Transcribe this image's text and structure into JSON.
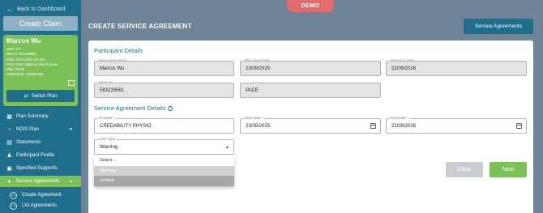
{
  "sidebar": {
    "back_label": "Back to Dashboard",
    "create_claim_label": "Create Claim",
    "user": {
      "name": "Marcos Wu",
      "lines": [
        "State: NT",
        "NDIS #: 583228561",
        "DOB: 01/01/2001 (24 yrs)",
        "Price Zone: National Very Remote",
        "Plan: PACE",
        "23/09/2025 - 22/09/2026"
      ],
      "switch_plan_label": "Switch Plan"
    },
    "nav": [
      {
        "label": "Plan Summary",
        "icon": "grid-icon"
      },
      {
        "label": "NDIS Plan",
        "icon": "gauge-icon"
      },
      {
        "label": "Statements",
        "icon": "document-icon"
      },
      {
        "label": "Participant Profile",
        "icon": "people-icon"
      },
      {
        "label": "Specified Supports",
        "icon": "book-icon"
      },
      {
        "label": "Service Agreements",
        "icon": "handshake-icon"
      }
    ],
    "sub_nav": [
      {
        "label": "Create Agreement",
        "badge": "CA"
      },
      {
        "label": "List Agreements",
        "badge": "LA"
      }
    ]
  },
  "header": {
    "demo_label": "DEMO",
    "title": "CREATE SERVICE AGREEMENT",
    "service_agreements_button": "Service Agreements"
  },
  "participant_details": {
    "section_title": "Participant Details",
    "participant_name": {
      "label": "Participant Name",
      "value": "Marcos Wu"
    },
    "plan_start_date": {
      "label": "Plan Start Date",
      "value": "23/09/2025"
    },
    "plan_end_date": {
      "label": "Plan End Date",
      "value": "22/09/2026"
    },
    "ndis_no": {
      "label": "NDIS No",
      "value": "583228561"
    },
    "plan_type": {
      "value": "PACE"
    }
  },
  "service_agreement_details": {
    "section_title": "Service Agreement Details",
    "provider": {
      "label": "Provider *",
      "value": "CREDABILITY PHYSIO"
    },
    "start_date": {
      "label": "Start Date *",
      "value": "23/09/2025"
    },
    "end_date": {
      "label": "End Date *",
      "value": "22/09/2026"
    },
    "limit_type": {
      "label": "Limit Type",
      "value": "Warning",
      "options": [
        "Select ...",
        "Warning",
        "Limited"
      ]
    }
  },
  "actions": {
    "clear_label": "Clear",
    "next_label": "Next"
  }
}
